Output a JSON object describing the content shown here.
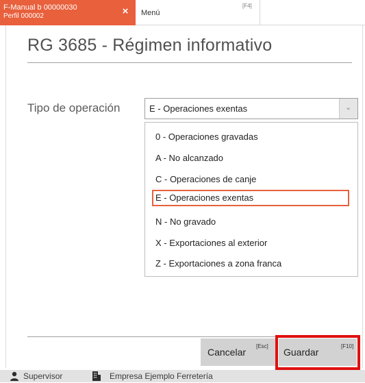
{
  "tabs": {
    "active": {
      "line1": "F-Manual b 00000030",
      "line2": "Perfil 000002",
      "close_glyph": "×"
    },
    "inactive": {
      "label": "Menú",
      "shortcut": "[F4]"
    }
  },
  "page": {
    "title": "RG 3685 - Régimen informativo"
  },
  "form": {
    "field_label": "Tipo de operación",
    "select_value": "E - Operaciones exentas",
    "options": [
      "0 - Operaciones gravadas",
      "A - No alcanzado",
      "C - Operaciones de canje",
      "E - Operaciones exentas",
      "N - No gravado",
      "X - Exportaciones al exterior",
      "Z - Exportaciones a zona franca"
    ],
    "selected_index": 3
  },
  "buttons": {
    "cancel_label": "Cancelar",
    "cancel_shortcut": "[Esc]",
    "save_label": "Guardar",
    "save_shortcut": "[F10]"
  },
  "status": {
    "user_icon": "user-icon",
    "user": "Supervisor",
    "company_icon": "building-icon",
    "company": "Empresa Ejemplo Ferretería"
  },
  "colors": {
    "accent": "#e8603c",
    "highlight_frame": "#e01010",
    "button_bg": "#d2d2d2",
    "status_bar_bg": "#e2e2e2"
  }
}
